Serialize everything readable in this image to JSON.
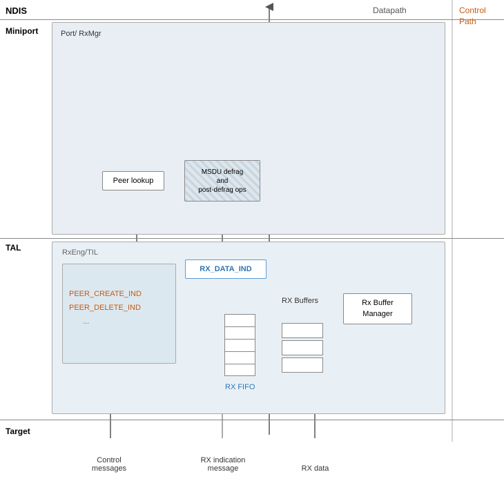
{
  "header": {
    "ndis_label": "NDIS",
    "datapath_label": "Datapath",
    "control_path_label": "Control Path"
  },
  "layers": {
    "miniport": "Miniport",
    "tal": "TAL",
    "target": "Target"
  },
  "components": {
    "port_rxmgr": "Port/\nRxMgr",
    "peer_lookup": "Peer lookup",
    "msdu_defrag": "MSDU defrag\nand\npost-defrag ops",
    "rx_data_ind": "RX_DATA_IND",
    "rxeng_til": "RxEng/TIL",
    "peer_create": "PEER_CREATE_IND",
    "peer_delete": "PEER_DELETE_IND",
    "peer_dots": "...",
    "rx_buffers_label": "RX Buffers",
    "rx_buffer_manager": "Rx Buffer\nManager",
    "rx_fifo_label": "RX FIFO"
  },
  "bottom_labels": {
    "control_messages": "Control\nmessages",
    "rx_indication": "RX indication\nmessage",
    "rx_data": "RX data"
  }
}
